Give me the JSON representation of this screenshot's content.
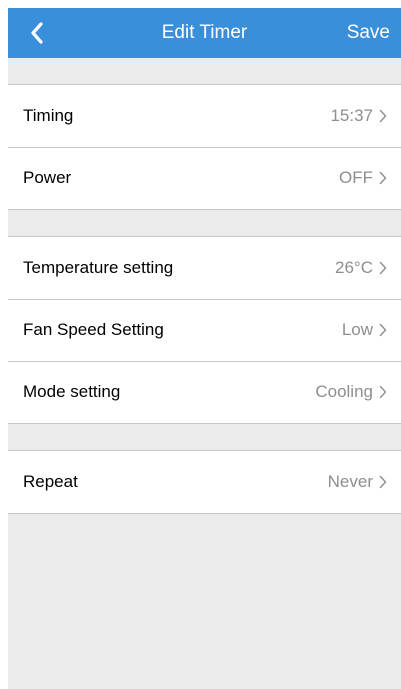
{
  "navbar": {
    "title": "Edit Timer",
    "save_label": "Save",
    "back_icon": "chevron-left-icon",
    "background": "#3a8fdb"
  },
  "groups": [
    {
      "rows": [
        {
          "label": "Timing",
          "value": "15:37"
        },
        {
          "label": "Power",
          "value": "OFF"
        }
      ]
    },
    {
      "rows": [
        {
          "label": "Temperature setting",
          "value": "26°C"
        },
        {
          "label": "Fan Speed Setting",
          "value": "Low"
        },
        {
          "label": "Mode setting",
          "value": "Cooling"
        }
      ]
    },
    {
      "rows": [
        {
          "label": "Repeat",
          "value": "Never"
        }
      ]
    }
  ]
}
